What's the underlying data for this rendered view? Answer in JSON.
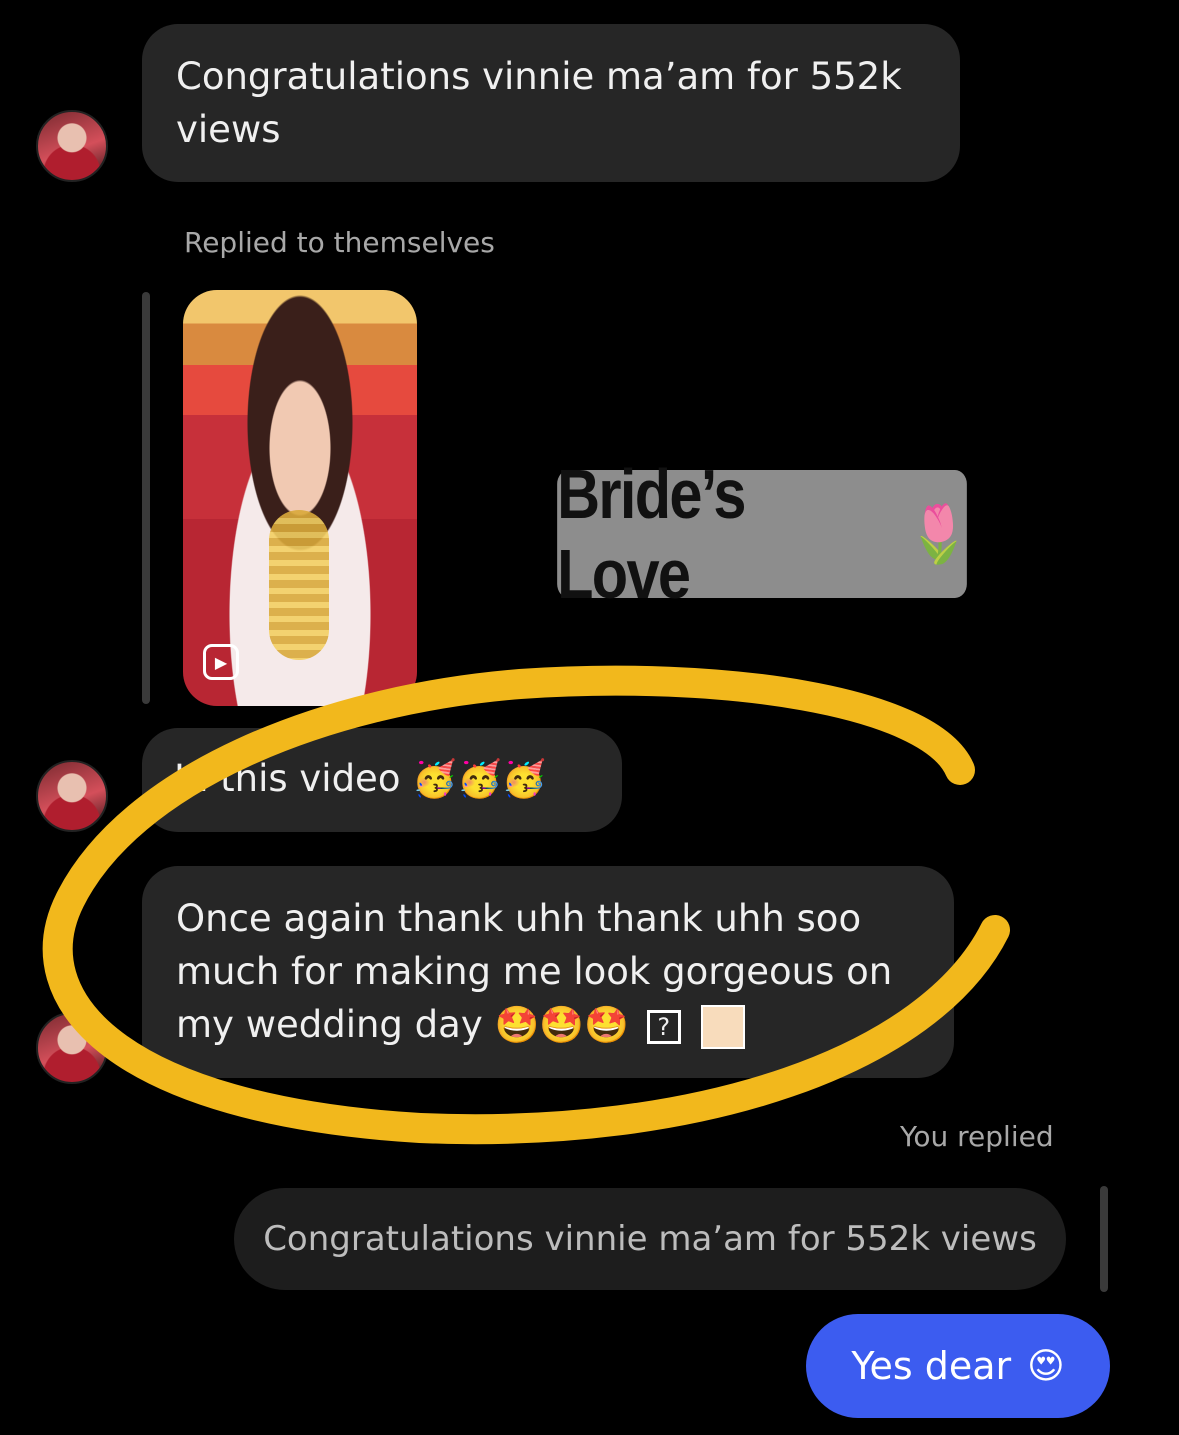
{
  "messages": {
    "first": "Congratulations vinnie ma’am for 552k views",
    "reply_meta": "Replied to themselves",
    "sticker_text": "Bride’s Love",
    "sticker_emoji": "🌷",
    "partial_text": "In this video",
    "partial_emojis": "🥳🥳🥳",
    "thanks_text": "Once again thank uhh thank uhh soo much for making me look gorgeous on my wedding day",
    "thanks_emojis": "🤩🤩🤩",
    "unknown_glyph": "?",
    "you_replied": "You replied",
    "quoted": "Congratulations vinnie ma’am for 552k views",
    "my_reply": "Yes dear",
    "my_reply_emoji": "😍"
  },
  "colors": {
    "outgoing_bubble": "#3c5cf0",
    "incoming_bubble": "#262626",
    "highlight_circle": "#f2b81c"
  },
  "icons": [
    "reel-icon",
    "avatar"
  ]
}
